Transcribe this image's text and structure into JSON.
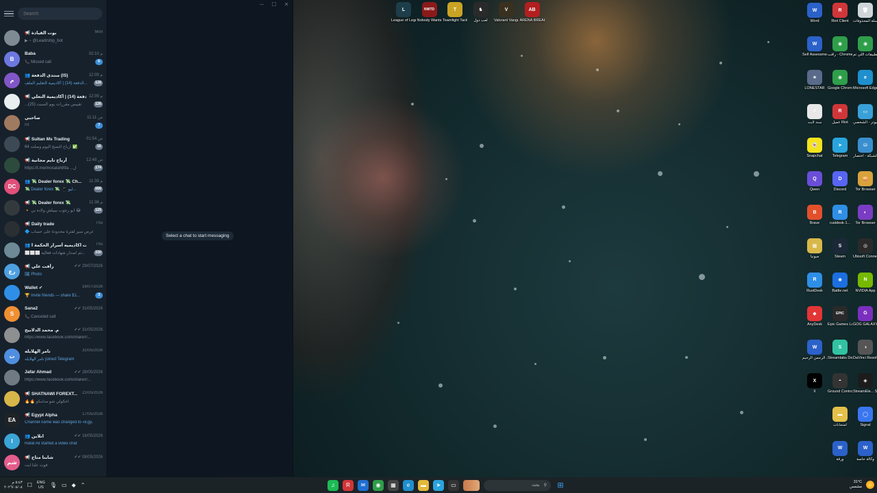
{
  "telegram": {
    "search_placeholder": "Search",
    "empty_state": "Select a chat to start messaging",
    "window_controls": {
      "minimize": "─",
      "maximize": "☐",
      "close": "✕"
    },
    "chats": [
      {
        "name": "📢 بوت القيادة",
        "time": "Mon",
        "preview": "▶ ~ @Leadrship_bot",
        "badge": "",
        "avatar_text": "",
        "avatar_color": "#7f8b92",
        "preview_blue": false
      },
      {
        "name": "Baba",
        "time": "02:10 م",
        "preview": "📞 Missed call",
        "badge": "6",
        "avatar_text": "B",
        "avatar_color": "#6c78e0",
        "preview_blue": false
      },
      {
        "name": "👥 منتدى الدفعة (IS)",
        "time": "12:09 م",
        "preview": "الدفعة (14) | أكاديمية التعليم الملف...",
        "badge": "126",
        "avatar_text": "م",
        "avatar_color": "#8156c8",
        "preview_blue": true
      },
      {
        "name": "📢 الدفعة (14) | أكاديمية التعلي...",
        "time": "12:09 م",
        "preview": "...تقييس مقررات يوم السبت (25)",
        "badge": "126",
        "avatar_text": "",
        "avatar_color": "#e9eef0",
        "preview_blue": false
      },
      {
        "name": "صاحبي",
        "time": "11:11 ص",
        "preview": "!!!!",
        "badge": "7",
        "avatar_text": "",
        "avatar_color": "#a07a60",
        "preview_blue": false
      },
      {
        "name": "📢 Sultan Ms Trading",
        "time": "01:54 ص",
        "preview": "أرباح النسخ اليوم وصلت 64 ✅",
        "badge": "16",
        "avatar_text": "",
        "avatar_color": "#3c4a55",
        "preview_blue": false
      },
      {
        "name": "📢 أرباح تايم مجانية",
        "time": "12:48 ص",
        "preview": "https://t.me/mosalah89a ...ل",
        "badge": "174",
        "avatar_text": "",
        "avatar_color": "#2d4b3c",
        "preview_blue": false
      },
      {
        "name": "👥 💸 Dealer forex 💸 Ch...",
        "time": "11:39 م",
        "preview": "💸 Dealer forex 💸: 📱 ليو...",
        "badge": "999",
        "avatar_text": "DC",
        "avatar_color": "#e0507a",
        "preview_blue": true
      },
      {
        "name": "📢 💸 Dealer forex 💸",
        "time": "11:38 م",
        "preview": "🔸 ابو رجوب بيبيلش ولاده بي 😂",
        "badge": "125",
        "avatar_text": "",
        "avatar_color": "#33393d",
        "preview_blue": false
      },
      {
        "name": "📢 Daily trade",
        "time": "Thu",
        "preview": "🔷 عرض سيز لفترة محدودة على حساب...",
        "badge": "",
        "avatar_text": "",
        "avatar_color": "#2a2f33",
        "preview_blue": false
      },
      {
        "name": "👥 شهادات اكاديميه أسرار الحكمة ا...",
        "time": "Thu",
        "preview": "⬜⬜⬜ تم اصدار شهادات فعالية...",
        "badge": "330",
        "avatar_text": "",
        "avatar_color": "#6d8a96",
        "preview_blue": false
      },
      {
        "name": "📢 رأفت علي",
        "time": "✔✔ 29/07/2026",
        "preview": "🖼 Photo",
        "badge": "",
        "avatar_text": "رع",
        "avatar_color": "#4ea0e0",
        "preview_blue": true
      },
      {
        "name": "Wallet ✔",
        "time": "16/07/2026",
        "preview": "🏆 Invite friends — share $1...",
        "badge": "3",
        "avatar_text": "",
        "avatar_color": "#2f8fe6",
        "preview_blue": true
      },
      {
        "name": "Sana2",
        "time": "✔✔ 31/05/2026",
        "preview": "📞 Canceled call",
        "badge": "",
        "avatar_text": "S",
        "avatar_color": "#f09033",
        "preview_blue": false
      },
      {
        "name": "م. محمد الدلابيح",
        "time": "✔✔ 31/05/2026",
        "preview": "https://www.facebook.com/share/r/...",
        "badge": "",
        "avatar_text": "",
        "avatar_color": "#8d8f91",
        "preview_blue": false
      },
      {
        "name": "تامر الهلايله",
        "time": "31/05/2026",
        "preview": "تامر الهلايله joined Telegram",
        "badge": "",
        "avatar_text": "ت",
        "avatar_color": "#4f8ee0",
        "preview_blue": true
      },
      {
        "name": "Jafar Ahmad",
        "time": "✔✔ 28/05/2026",
        "preview": "https://www.facebook.com/share/r/...",
        "badge": "",
        "avatar_text": "",
        "avatar_color": "#6f7a82",
        "preview_blue": false
      },
      {
        "name": "📢 SHATNAWI FOREXT...",
        "time": "21/05/2026",
        "preview": "🔥🔥 احكولي شو مدامكو",
        "badge": "",
        "avatar_text": "",
        "avatar_color": "#d7b64a",
        "preview_blue": false
      },
      {
        "name": "📢 Egypt Alpha",
        "time": "17/05/2026",
        "preview": "Channel name was changed to «Egy...",
        "badge": "",
        "avatar_text": "EA",
        "avatar_color": "#1f2326",
        "preview_blue": true
      },
      {
        "name": "👥 انلاين",
        "time": "✔✔ 16/05/2026",
        "preview": "Rafat Ali started a video chat",
        "badge": "",
        "avatar_text": "I",
        "avatar_color": "#3aa5d6",
        "preview_blue": true
      },
      {
        "name": "📢 شابنا متاح",
        "time": "✔✔ 08/05/2026",
        "preview": "فوت علنا ابت",
        "badge": "",
        "avatar_text": "شم",
        "avatar_color": "#e45d8c",
        "preview_blue": false
      }
    ]
  },
  "desktop_icons": {
    "top_row": [
      {
        "label": "League of Legends",
        "glyph": "L",
        "color": "#1d3d4a"
      },
      {
        "label": "Nobody Wants to D...",
        "glyph": "NWTD",
        "color": "#8a1a1a"
      },
      {
        "label": "Teamfight Tactics",
        "glyph": "T",
        "color": "#caa324"
      },
      {
        "label": "لعب دول",
        "glyph": "♞",
        "color": "#2a2a2a"
      },
      {
        "label": "Valorant Vanguard Mech",
        "glyph": "V",
        "color": "#3a3020"
      },
      {
        "label": "ARENA BREAKOUT",
        "glyph": "AB",
        "color": "#b31f1f"
      }
    ],
    "right_grid": [
      {
        "label": "Word",
        "glyph": "W",
        "color": "#2b61c9"
      },
      {
        "label": "Riot Client",
        "glyph": "R",
        "color": "#d13639"
      },
      {
        "label": "سلة المحذوفات",
        "glyph": "🗑",
        "color": "#cfd6da"
      },
      {
        "label": "Self Assessmen...",
        "glyph": "W",
        "color": "#2b61c9"
      },
      {
        "label": "راقت - Chrome",
        "glyph": "◉",
        "color": "#2f9e4a"
      },
      {
        "label": "التطبيقات اللي تم...",
        "glyph": "◉",
        "color": "#2f9e4a"
      },
      {
        "label": "LONESTAR",
        "glyph": "★",
        "color": "#5a6a8a"
      },
      {
        "label": "Google Chrome",
        "glyph": "◉",
        "color": "#2f9e4a"
      },
      {
        "label": "Microsoft Edge",
        "glyph": "e",
        "color": "#1f8fce"
      },
      {
        "label": "سند لايت",
        "glyph": "≡",
        "color": "#e8e8e8"
      },
      {
        "label": "عميل Riot",
        "glyph": "R",
        "color": "#d13639"
      },
      {
        "label": "هذا الكمبيوتر - الشخصي",
        "glyph": "▭",
        "color": "#3aa0d8"
      },
      {
        "label": "Snapchat",
        "glyph": "👻",
        "color": "#f5e31c"
      },
      {
        "label": "Telegram",
        "glyph": "➤",
        "color": "#2aa4dd"
      },
      {
        "label": "الشبكة - اختصار",
        "glyph": "⛁",
        "color": "#3a8fcf"
      },
      {
        "label": "Qwen",
        "glyph": "Q",
        "color": "#6b4ed8"
      },
      {
        "label": "Discord",
        "glyph": "D",
        "color": "#5865f2"
      },
      {
        "label": "Tor Browser",
        "glyph": "🧅",
        "color": "#d9a23c"
      },
      {
        "label": "Brave",
        "glyph": "B",
        "color": "#e2502b"
      },
      {
        "label": "rustdesk-1...",
        "glyph": "R",
        "color": "#2f8fe6"
      },
      {
        "label": "Tor Browser",
        "glyph": "◐",
        "color": "#7b3cc4"
      },
      {
        "label": "ميونيا",
        "glyph": "▦",
        "color": "#d9b84a"
      },
      {
        "label": "Steam",
        "glyph": "S",
        "color": "#1b2838"
      },
      {
        "label": "Ubisoft Connect",
        "glyph": "◎",
        "color": "#2a2a2a"
      },
      {
        "label": "RustDesk",
        "glyph": "R",
        "color": "#2f8fe6"
      },
      {
        "label": "Battle.net",
        "glyph": "✺",
        "color": "#1c6fe0"
      },
      {
        "label": "NVIDIA App",
        "glyph": "N",
        "color": "#76b900"
      },
      {
        "label": "AnyDesk",
        "glyph": "◆",
        "color": "#e33535"
      },
      {
        "label": "Epic Games Launcher",
        "glyph": "EPIC",
        "color": "#2a2a2a"
      },
      {
        "label": "GOG GALAXY",
        "glyph": "G",
        "color": "#7b2fbf"
      },
      {
        "label": "بسم الله الرحمن الرحيم",
        "glyph": "W",
        "color": "#2b61c9"
      },
      {
        "label": "Streamlabs Desktop",
        "glyph": "S",
        "color": "#31c3a2"
      },
      {
        "label": "DaVinci Resolve",
        "glyph": "◑",
        "color": "#555"
      },
      {
        "label": "X",
        "glyph": "X",
        "color": "#000"
      },
      {
        "label": "Ground Control",
        "glyph": "◓",
        "color": "#333"
      },
      {
        "label": "StreamEle... SE.Live",
        "glyph": "◈",
        "color": "#1c1c1c"
      },
      {
        "label": "",
        "glyph": "",
        "color": ""
      },
      {
        "label": "امتحانات",
        "glyph": "▬",
        "color": "#e4c04a"
      },
      {
        "label": "Signal",
        "glyph": "◯",
        "color": "#3a76f0"
      },
      {
        "label": "",
        "glyph": "",
        "color": ""
      },
      {
        "label": "ورقة",
        "glyph": "W",
        "color": "#2b61c9"
      },
      {
        "label": "وكالة خاصة",
        "glyph": "W",
        "color": "#2b61c9"
      }
    ]
  },
  "taskbar": {
    "time": "٥:٤٣ م",
    "date": "٢٠٢٦/٠٨/٠٨",
    "lang_top": "ENG",
    "lang_bottom": "US",
    "search_text": "بحث",
    "weather_temp": "31°C",
    "weather_desc": "مشمس",
    "apps": [
      {
        "name": "taskbar-app-spotify",
        "glyph": "♫",
        "color": "#1db954"
      },
      {
        "name": "taskbar-app-riot",
        "glyph": "R",
        "color": "#d13639"
      },
      {
        "name": "taskbar-app-mail",
        "glyph": "✉",
        "color": "#1f6fd1"
      },
      {
        "name": "taskbar-app-chrome",
        "glyph": "◉",
        "color": "#2f9e4a"
      },
      {
        "name": "taskbar-app-store",
        "glyph": "▦",
        "color": "#444"
      },
      {
        "name": "taskbar-app-edge",
        "glyph": "e",
        "color": "#1f8fce"
      },
      {
        "name": "taskbar-app-explorer",
        "glyph": "▬",
        "color": "#e4b93a"
      },
      {
        "name": "taskbar-app-telegram",
        "glyph": "➤",
        "color": "#2aa4dd"
      },
      {
        "name": "taskbar-app-terminal",
        "glyph": "▭",
        "color": "#333"
      }
    ]
  }
}
